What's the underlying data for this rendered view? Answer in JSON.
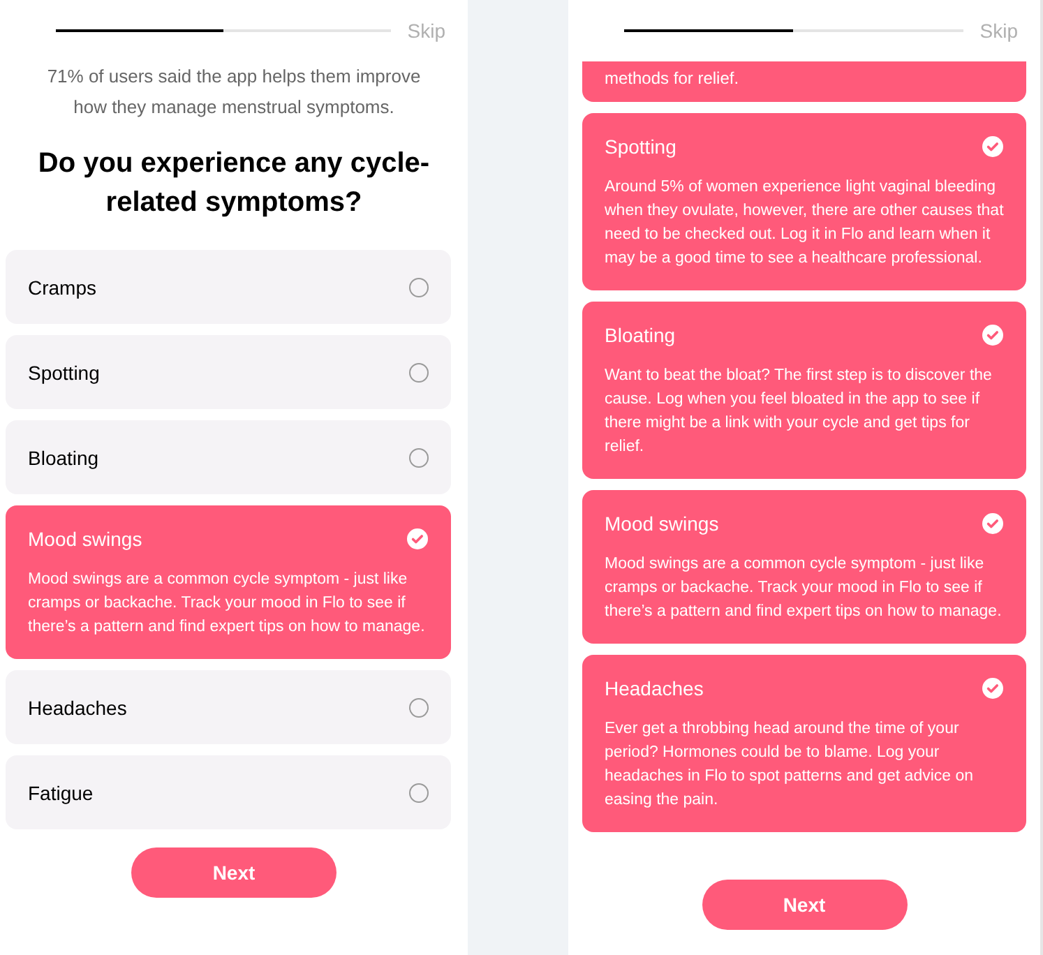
{
  "screens": [
    {
      "progress": {
        "level": 0.5
      },
      "skip": "Skip",
      "intro": "71% of users said the app helps them improve how they manage menstrual symptoms.",
      "question": "Do you experience any cycle-related symptoms?",
      "options": [
        {
          "kind": "option",
          "label": "Cramps",
          "selected": false
        },
        {
          "kind": "option",
          "label": "Spotting",
          "selected": false
        },
        {
          "kind": "option",
          "label": "Bloating",
          "selected": false
        },
        {
          "kind": "option",
          "label": "Mood swings",
          "selected": true,
          "description": "Mood swings are a common cycle symptom - just like cramps or backache. Track your mood in Flo to see if there’s a pattern and find expert tips on how to manage."
        },
        {
          "kind": "option",
          "label": "Headaches",
          "selected": false
        },
        {
          "kind": "option",
          "label": "Fatigue",
          "selected": false
        }
      ],
      "next": "Next"
    },
    {
      "progress": {
        "level": 0.5
      },
      "skip": "Skip",
      "options": [
        {
          "kind": "fragment",
          "selected": true,
          "description": "methods for relief."
        },
        {
          "kind": "option",
          "label": "Spotting",
          "selected": true,
          "description": "Around 5% of women experience light vaginal bleeding when they ovulate, however, there are other causes that need to be checked out. Log it in Flo and learn when it may be a good time to see a healthcare professional."
        },
        {
          "kind": "option",
          "label": "Bloating",
          "selected": true,
          "description": "Want to beat the bloat? The first step is to discover the cause. Log when you feel bloated in the app to see if there might be a link with your cycle and get tips for relief."
        },
        {
          "kind": "option",
          "label": "Mood swings",
          "selected": true,
          "description": "Mood swings are a common cycle symptom - just like cramps or backache. Track your mood in Flo to see if there’s a pattern and find expert tips on how to manage."
        },
        {
          "kind": "option",
          "label": "Headaches",
          "selected": true,
          "description": "Ever get a throbbing head around the time of your period? Hormones could be to blame. Log your headaches in Flo to spot patterns and get advice on easing the pain."
        }
      ],
      "next": "Next"
    }
  ]
}
